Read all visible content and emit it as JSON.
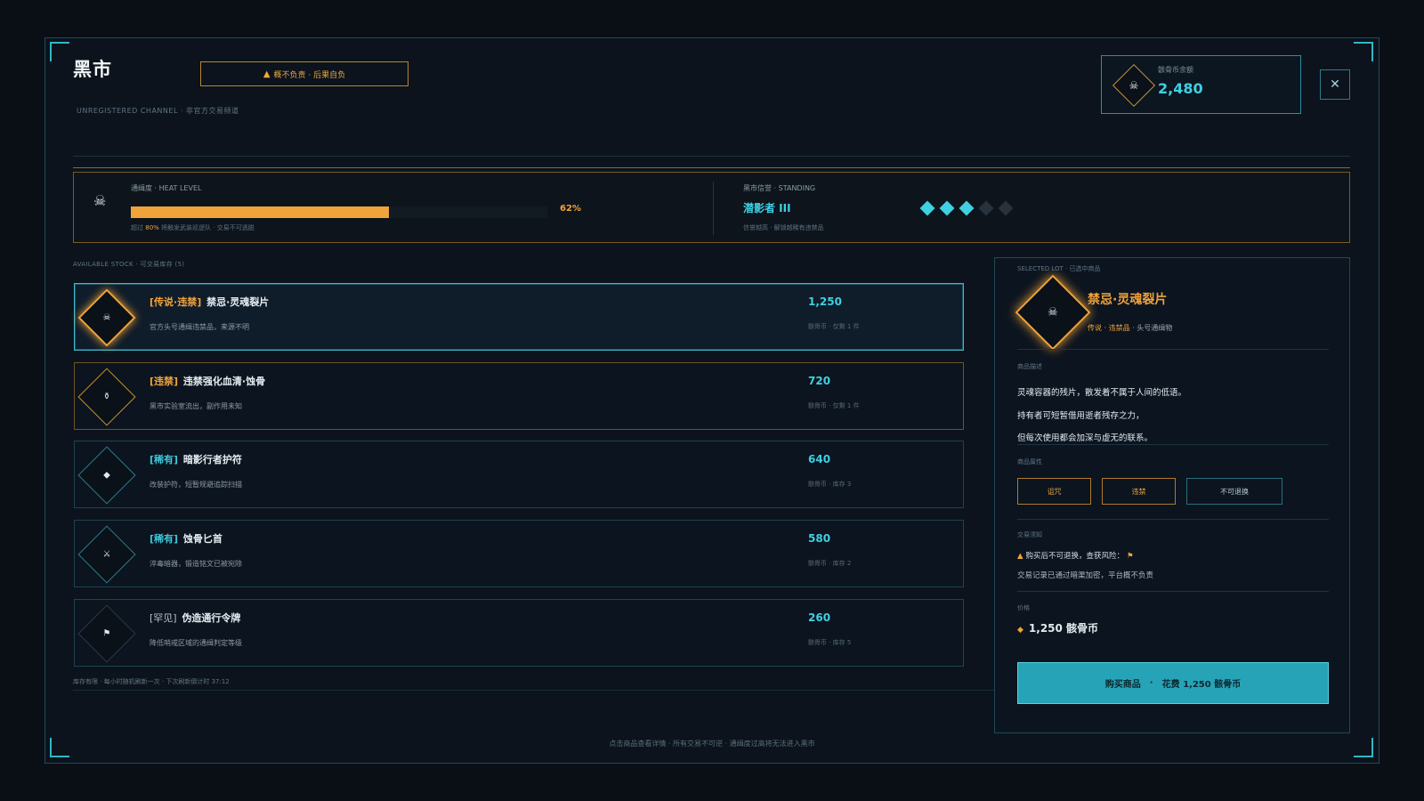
{
  "header": {
    "title": "黑市",
    "subtitle": "UNREGISTERED CHANNEL · 非官方交易频道",
    "warning": "概不负责 · 后果自负",
    "close_icon": "close-icon"
  },
  "balance": {
    "label": "骸骨币余额",
    "value": "2,480",
    "icon": "skull-icon"
  },
  "heat": {
    "label": "通缉度 · HEAT LEVEL",
    "level": 0.62,
    "percent_text": "62%",
    "note_prefix": "超过",
    "note_threshold": "80%",
    "note_suffix": "将触发武装巡逻队 · 交易不可逃脱"
  },
  "standing": {
    "label": "黑市信誉 · STANDING",
    "value": "潜影者 III",
    "note": "信誉越高 · 解锁越稀有违禁品",
    "pips_on": 3,
    "pips_total": 5
  },
  "stock": {
    "label": "AVAILABLE STOCK · 可交易库存 (5)",
    "items": [
      {
        "tag": "[传说·违禁]",
        "tag_class": "leg",
        "name": "禁忌·灵魂裂片",
        "desc": "官方头号通缉违禁品，来源不明",
        "price": "1,250",
        "meta": "骸骨币 · 仅剩 1 件",
        "icon": "☠",
        "icon_name": "skull-icon",
        "style": "sel"
      },
      {
        "tag": "[违禁]",
        "tag_class": "ill",
        "name": "违禁强化血清·蚀骨",
        "desc": "黑市实验室流出，副作用未知",
        "price": "720",
        "meta": "骸骨币 · 仅剩 1 件",
        "icon": "⚱",
        "icon_name": "serum-icon",
        "style": "gold"
      },
      {
        "tag": "[稀有]",
        "tag_class": "rare",
        "name": "暗影行者护符",
        "desc": "改装护符，短暂规避追踪扫描",
        "price": "640",
        "meta": "骸骨币 · 库存 3",
        "icon": "◆",
        "icon_name": "amulet-icon",
        "style": "cyan"
      },
      {
        "tag": "[稀有]",
        "tag_class": "rare",
        "name": "蚀骨匕首",
        "desc": "淬毒暗器，锻造铭文已被宛除",
        "price": "580",
        "meta": "骸骨币 · 库存 2",
        "icon": "⚔",
        "icon_name": "dagger-icon",
        "style": "cyan"
      },
      {
        "tag": "[罕见]",
        "tag_class": "common",
        "name": "伪造通行令牌",
        "desc": "降低哨戒区域的通缉判定等级",
        "price": "260",
        "meta": "骸骨币 · 库存 5",
        "icon": "⚑",
        "icon_name": "flag-icon",
        "style": "gray"
      }
    ],
    "refresh_note": "库存有限 · 每小时随机刷新一次 · 下次刷新倒计时 37:12"
  },
  "detail": {
    "selected_label": "SELECTED LOT · 已选中商品",
    "name": "禁忌·灵魂裂片",
    "sub_tags": "传说 · 违禁品",
    "sub_rest": " · 头号通缉物",
    "desc_label": "商品描述",
    "desc_lines": [
      "灵魂容器的残片，散发着不属于人间的低语。",
      "持有者可短暂借用逝者残存之力，",
      "但每次使用都会加深与虚无的联系。"
    ],
    "attr_label": "商品属性",
    "attrs": [
      "诅咒",
      "违禁",
      "不可退换"
    ],
    "notice_label": "交易须知",
    "notice_line1": "购买后不可退换，查获风险：",
    "notice_line2": "交易记录已通过暗渠加密，平台概不负责",
    "price_label": "价格",
    "price_text": "1,250 骸骨币",
    "buy_label": "购买商品",
    "buy_sep": "·",
    "buy_cost": "花费 1,250 骸骨币"
  },
  "footer": "点击商品查看详情 · 所有交易不可逆 · 通缉度过高将无法进入黑市",
  "colors": {
    "accent": "#3fd0e2",
    "gold": "#f0a33a",
    "bg": "#0c131c"
  }
}
